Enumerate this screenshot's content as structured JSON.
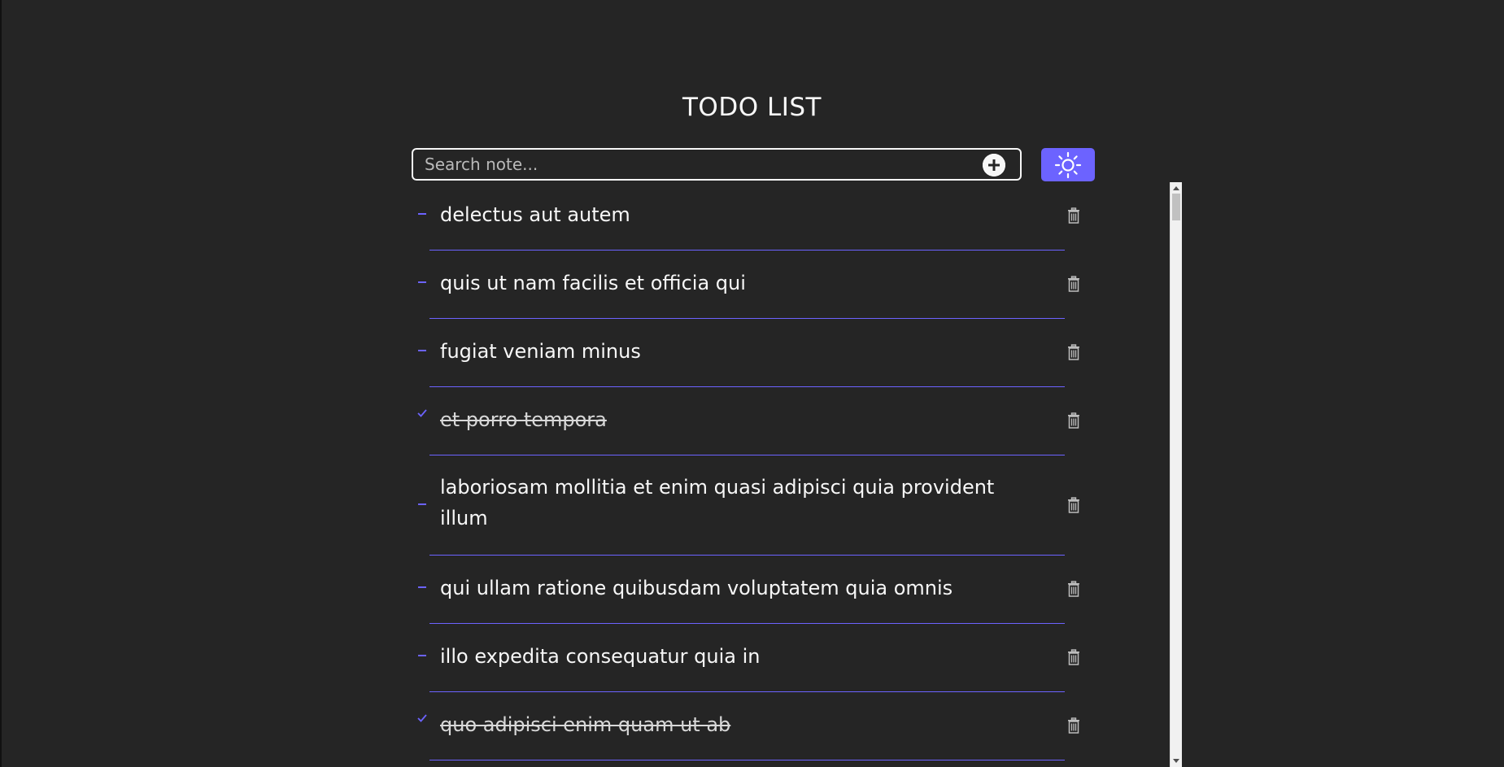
{
  "app": {
    "title": "TODO LIST"
  },
  "search": {
    "placeholder": "Search note...",
    "value": ""
  },
  "icons": {
    "add": "plus-circle-icon",
    "theme": "sun-icon",
    "pending": "dash-icon",
    "completed": "checkmark-icon",
    "delete": "trash-icon"
  },
  "colors": {
    "background": "#252525",
    "accent": "#6c63ff",
    "text": "#f7f7f7"
  },
  "todos": [
    {
      "text": "delectus aut autem",
      "completed": false
    },
    {
      "text": "quis ut nam facilis et officia qui",
      "completed": false
    },
    {
      "text": "fugiat veniam minus",
      "completed": false
    },
    {
      "text": "et porro tempora",
      "completed": true
    },
    {
      "text": "laboriosam mollitia et enim quasi adipisci quia provident illum",
      "completed": false
    },
    {
      "text": "qui ullam ratione quibusdam voluptatem quia omnis",
      "completed": false
    },
    {
      "text": "illo expedita consequatur quia in",
      "completed": false
    },
    {
      "text": "quo adipisci enim quam ut ab",
      "completed": true
    }
  ]
}
